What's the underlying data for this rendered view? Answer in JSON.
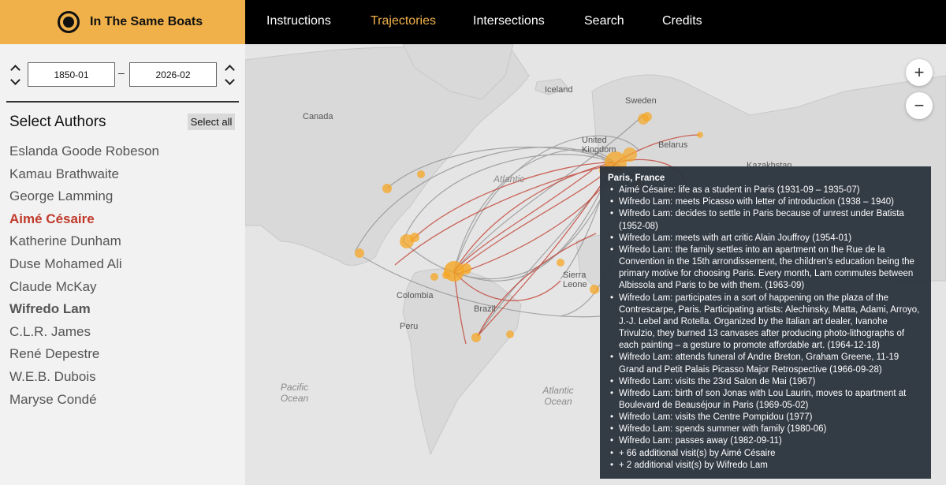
{
  "app": {
    "title": "In The Same Boats"
  },
  "nav": [
    {
      "label": "Instructions",
      "active": false
    },
    {
      "label": "Trajectories",
      "active": true
    },
    {
      "label": "Intersections",
      "active": false
    },
    {
      "label": "Search",
      "active": false
    },
    {
      "label": "Credits",
      "active": false
    }
  ],
  "date_range": {
    "start": "1850-01",
    "separator": "–",
    "end": "2026-02"
  },
  "authors_panel": {
    "title": "Select Authors",
    "select_all_label": "Select all",
    "authors": [
      {
        "name": "Eslanda Goode Robeson",
        "state": "none"
      },
      {
        "name": "Kamau Brathwaite",
        "state": "none"
      },
      {
        "name": "George Lamming",
        "state": "none"
      },
      {
        "name": "Aimé Césaire",
        "state": "primary"
      },
      {
        "name": "Katherine Dunham",
        "state": "none"
      },
      {
        "name": "Duse Mohamed Ali",
        "state": "none"
      },
      {
        "name": "Claude McKay",
        "state": "none"
      },
      {
        "name": "Wifredo Lam",
        "state": "secondary"
      },
      {
        "name": "C.L.R. James",
        "state": "none"
      },
      {
        "name": "René Depestre",
        "state": "none"
      },
      {
        "name": "W.E.B. Dubois",
        "state": "none"
      },
      {
        "name": "Maryse Condé",
        "state": "none"
      }
    ]
  },
  "map": {
    "labels": {
      "iceland": "Iceland",
      "sweden": "Sweden",
      "canada": "Canada",
      "united_kingdom": "United Kingdom",
      "belarus": "Belarus",
      "kazakhstan": "Kazakhstan",
      "atlantic_north": "Atlantic",
      "sierra_leone": "Sierra Leone",
      "colombia": "Colombia",
      "peru": "Peru",
      "brazil": "Brazil",
      "pacific_ocean": "Pacific Ocean",
      "atlantic_ocean": "Atlantic Ocean"
    },
    "zoom_in": "+",
    "zoom_out": "−",
    "colors": {
      "primary_route": "#c0392b",
      "secondary_route": "#888888",
      "marker": "#f5a623"
    }
  },
  "tooltip": {
    "title": "Paris, France",
    "entries": [
      "Aimé Césaire: life as a student in Paris (1931-09 – 1935-07)",
      "Wifredo Lam: meets Picasso with letter of introduction (1938 – 1940)",
      "Wifredo Lam: decides to settle in Paris because of unrest under Batista (1952-08)",
      "Wifredo Lam: meets with art critic Alain Jouffroy (1954-01)",
      "Wifredo Lam: the family settles into an apartment on the Rue de la Convention in the 15th arrondissement, the children's education being the primary motive for choosing Paris. Every month, Lam commutes between Albissola and Paris to be with them. (1963-09)",
      "Wifredo Lam: participates in a sort of happening on the plaza of the Contrescarpe, Paris. Participating artists: Alechinsky, Matta, Adami, Arroyo, J.-J. Lebel and Rotella. Organized by the Italian art dealer, Ivanohe Trivulzio, they burned 13 canvases after producing photo-lithographs of each painting – a gesture to promote affordable art. (1964-12-18)",
      "Wifredo Lam: attends funeral of Andre Breton, Graham Greene, 11-19 Grand and Petit Palais Picasso Major Retrospective (1966-09-28)",
      "Wifredo Lam: visits the 23rd Salon de Mai (1967)",
      "Wifredo Lam: birth of son Jonas with Lou Laurin, moves to apartment at Boulevard de Beauséjour in Paris (1969-05-02)",
      "Wifredo Lam: visits the Centre Pompidou (1977)",
      "Wifredo Lam: spends summer with family (1980-06)",
      "Wifredo Lam: passes away (1982-09-11)",
      "+ 66 additional visit(s) by Aimé Césaire",
      "+ 2 additional visit(s) by Wifredo Lam"
    ]
  }
}
